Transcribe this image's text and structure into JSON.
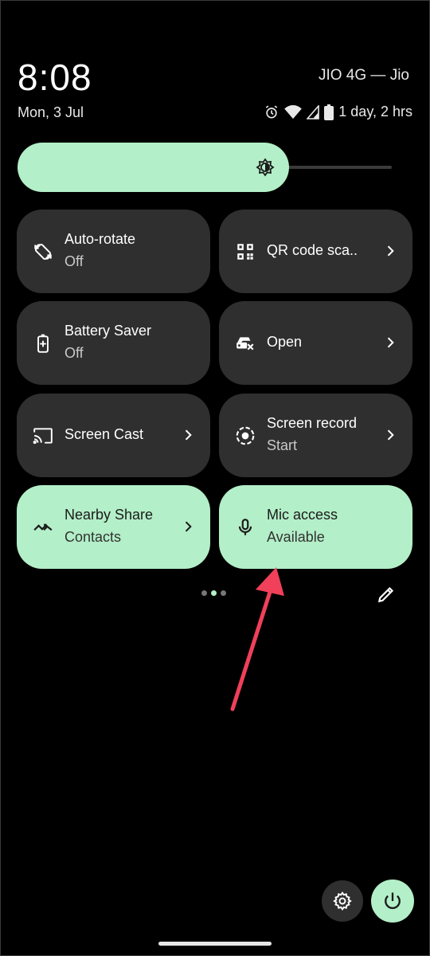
{
  "status_bar": {
    "time": "8:08",
    "carrier": "JIO 4G — Jio",
    "date": "Mon, 3 Jul",
    "battery_text": "1 day, 2 hrs"
  },
  "brightness": {
    "level": 0.7,
    "icon": "brightness-icon"
  },
  "tiles": [
    {
      "label": "Auto-rotate",
      "sub": "Off",
      "icon": "auto-rotate-icon",
      "active": false
    },
    {
      "label": "QR code sca..",
      "sub": "",
      "icon": "qr-code-icon",
      "active": false
    },
    {
      "label": "Battery Saver",
      "sub": "Off",
      "icon": "battery-saver-icon",
      "active": false
    },
    {
      "label": "Open",
      "sub": "",
      "icon": "car-icon",
      "active": false
    },
    {
      "label": "Screen Cast",
      "sub": "",
      "icon": "cast-icon",
      "active": false
    },
    {
      "label": "Screen record",
      "sub": "Start",
      "icon": "screen-record-icon",
      "active": false
    },
    {
      "label": "Nearby Share",
      "sub": "Contacts",
      "icon": "nearby-share-icon",
      "active": true
    },
    {
      "label": "Mic access",
      "sub": "Available",
      "icon": "mic-icon",
      "active": true
    }
  ],
  "pager": {
    "pages": 3,
    "current": 2
  },
  "colors": {
    "accent": "#b3efc8",
    "tile_bg": "#2f2f2f",
    "annotation_arrow": "#f0405a"
  }
}
